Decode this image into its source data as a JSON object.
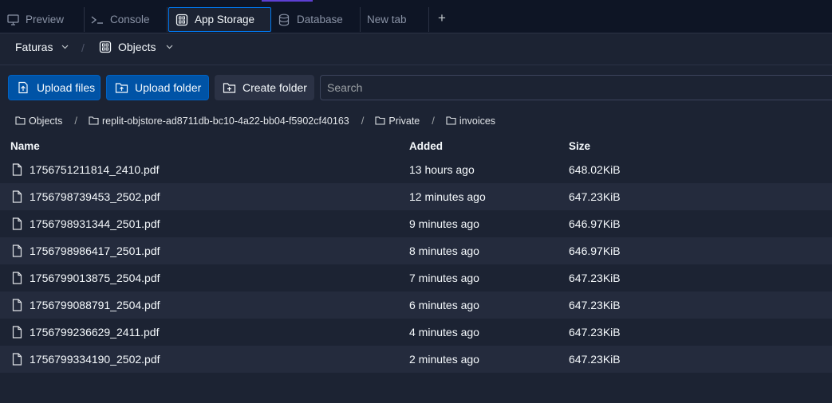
{
  "tabs": [
    {
      "label": "Preview",
      "icon": "monitor-icon"
    },
    {
      "label": "Console",
      "icon": "terminal-icon"
    },
    {
      "label": "App Storage",
      "icon": "storage-icon",
      "active": true
    },
    {
      "label": "Database",
      "icon": "database-icon"
    },
    {
      "label": "New tab"
    }
  ],
  "bucket_select": {
    "label": "Faturas"
  },
  "view_select": {
    "label": "Objects"
  },
  "toolbar": {
    "upload_files": "Upload files",
    "upload_folder": "Upload folder",
    "create_folder": "Create folder",
    "search_placeholder": "Search"
  },
  "breadcrumb": [
    "Objects",
    "replit-objstore-ad8711db-bc10-4a22-bb04-f5902cf40163",
    "Private",
    "invoices"
  ],
  "table": {
    "headers": {
      "name": "Name",
      "added": "Added",
      "size": "Size"
    },
    "rows": [
      {
        "name": "1756751211814_2410.pdf",
        "added": "13 hours ago",
        "size": "648.02KiB"
      },
      {
        "name": "1756798739453_2502.pdf",
        "added": "12 minutes ago",
        "size": "647.23KiB"
      },
      {
        "name": "1756798931344_2501.pdf",
        "added": "9 minutes ago",
        "size": "646.97KiB"
      },
      {
        "name": "1756798986417_2501.pdf",
        "added": "8 minutes ago",
        "size": "646.97KiB"
      },
      {
        "name": "1756799013875_2504.pdf",
        "added": "7 minutes ago",
        "size": "647.23KiB"
      },
      {
        "name": "1756799088791_2504.pdf",
        "added": "6 minutes ago",
        "size": "647.23KiB"
      },
      {
        "name": "1756799236629_2411.pdf",
        "added": "4 minutes ago",
        "size": "647.23KiB"
      },
      {
        "name": "1756799334190_2502.pdf",
        "added": "2 minutes ago",
        "size": "647.23KiB"
      }
    ]
  },
  "colors": {
    "background": "#1c2333",
    "primary_button": "#0053a6",
    "active_tab_border": "#0079f2"
  }
}
